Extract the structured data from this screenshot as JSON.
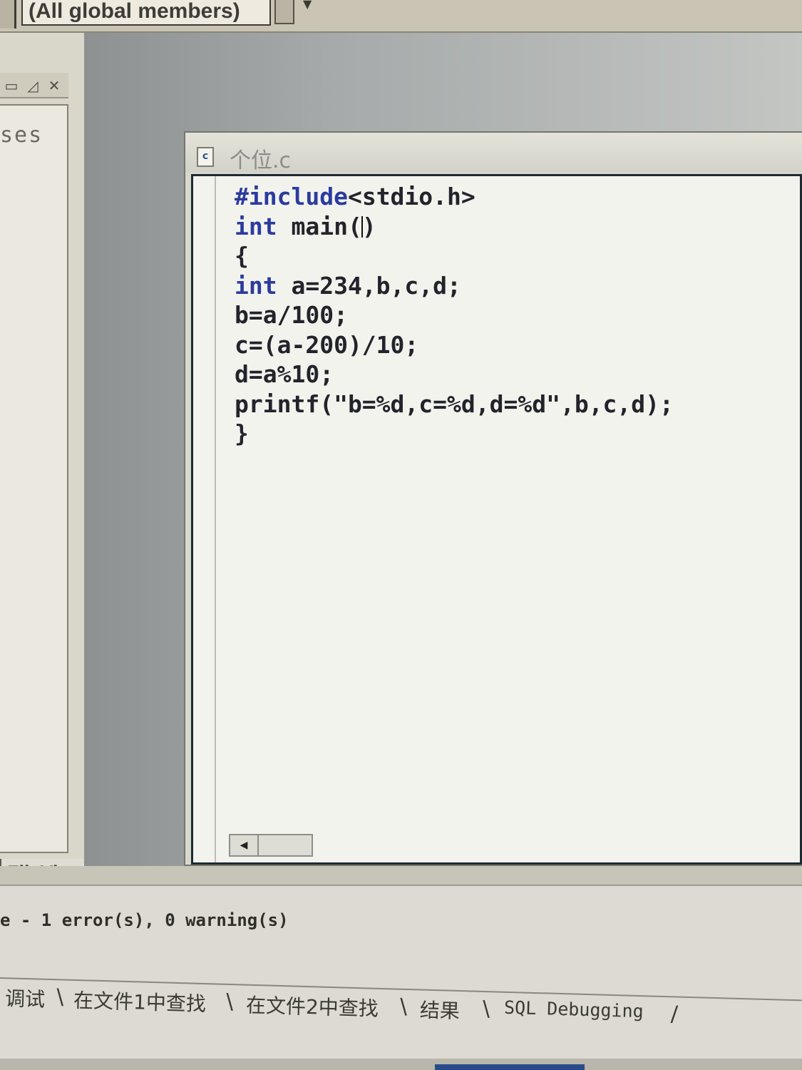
{
  "toolbar": {
    "members_combo": "(All global members)"
  },
  "workspace": {
    "tree_label": "ses",
    "tab_fileview": "FileView"
  },
  "document": {
    "title": "个位.c"
  },
  "code_lines": [
    "#include<stdio.h>",
    "int main()",
    "{",
    "int a=234,b,c,d;",
    "b=a/100;",
    "c=(a-200)/10;",
    "d=a%10;",
    "printf(\"b=%d,c=%d,d=%d\",b,c,d);",
    "}"
  ],
  "output": {
    "build_result": "e - 1 error(s), 0 warning(s)",
    "tabs": [
      "调试",
      "在文件1中查找",
      "在文件2中查找",
      "结果",
      "SQL Debugging"
    ]
  },
  "colors": {
    "keyword": "#2b3b9e",
    "code_text": "#23232b",
    "editor_bg": "#f3f3ee"
  }
}
